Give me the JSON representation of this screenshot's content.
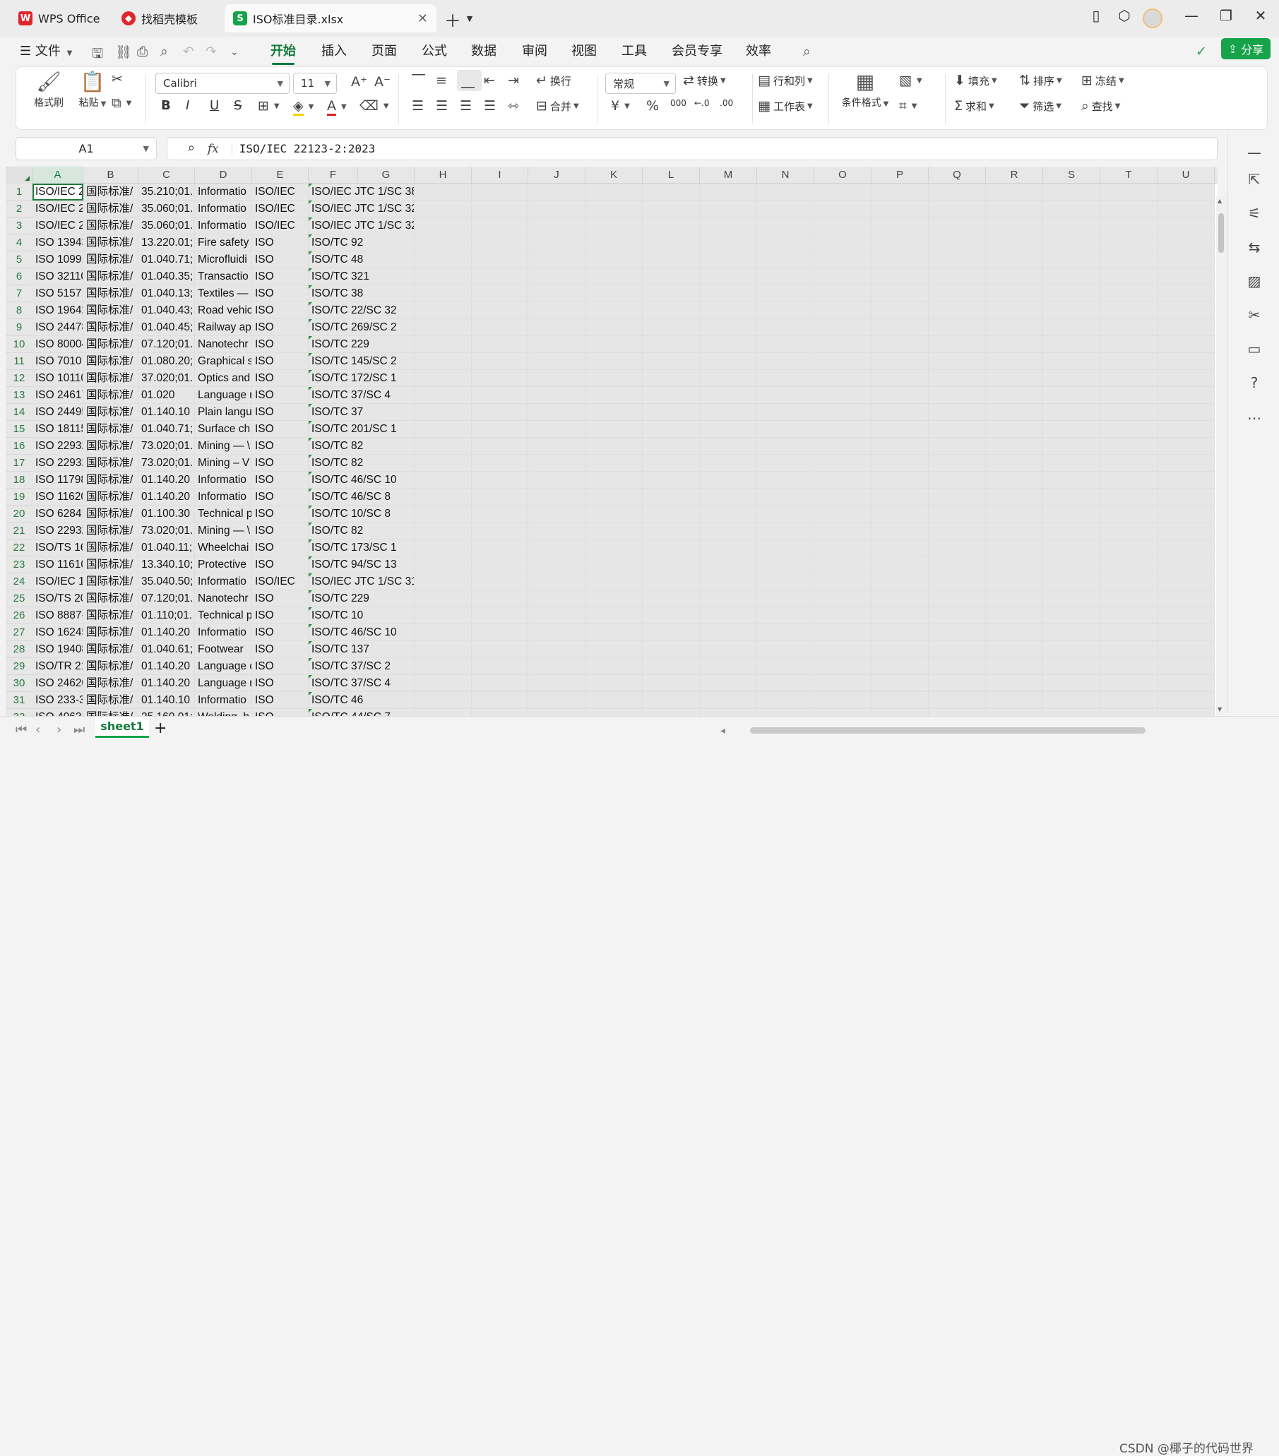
{
  "tabs": {
    "wps": "WPS Office",
    "template": "找稻壳模板",
    "file": "ISO标准目录.xlsx"
  },
  "menu": {
    "file": "文件",
    "items": [
      "开始",
      "插入",
      "页面",
      "公式",
      "数据",
      "审阅",
      "视图",
      "工具",
      "会员专享",
      "效率"
    ],
    "share": "分享"
  },
  "ribbon": {
    "format_painter": "格式刷",
    "paste": "粘贴",
    "font": "Calibri",
    "size": "11",
    "wrap": "换行",
    "merge": "合并",
    "number_format": "常规",
    "convert": "转换",
    "row_col": "行和列",
    "worksheet": "工作表",
    "cond_format": "条件格式",
    "fill": "填充",
    "sort": "排序",
    "freeze": "冻结",
    "sum": "求和",
    "filter": "筛选",
    "find": "查找",
    "currency": "¥",
    "percent": "%",
    "thousands": "000"
  },
  "formula": {
    "name_box": "A1",
    "fx": "fx",
    "content": "ISO/IEC 22123-2:2023"
  },
  "columns": [
    "A",
    "B",
    "C",
    "D",
    "E",
    "F",
    "G",
    "H",
    "I",
    "J",
    "K",
    "L",
    "M",
    "N",
    "O",
    "P",
    "Q",
    "R",
    "S",
    "T",
    "U"
  ],
  "rows": [
    [
      "1",
      "ISO/IEC 22",
      "国际标准/",
      "35.210;01.",
      "Informatio",
      "ISO/IEC",
      "ISO/IEC JTC 1/SC 38"
    ],
    [
      "2",
      "ISO/IEC 21",
      "国际标准/",
      "35.060;01.",
      "Informatio",
      "ISO/IEC",
      "ISO/IEC JTC 1/SC 32"
    ],
    [
      "3",
      "ISO/IEC 21",
      "国际标准/",
      "35.060;01.",
      "Informatio",
      "ISO/IEC",
      "ISO/IEC JTC 1/SC 32"
    ],
    [
      "4",
      "ISO 13943:",
      "国际标准/",
      "13.220.01;",
      "Fire safety",
      "ISO",
      "ISO/TC 92"
    ],
    [
      "5",
      "ISO 10991:",
      "国际标准/",
      "01.040.71;",
      "Microfluidi",
      "ISO",
      "ISO/TC 48"
    ],
    [
      "6",
      "ISO 32110:",
      "国际标准/",
      "01.040.35;",
      "Transactio",
      "ISO",
      "ISO/TC 321"
    ],
    [
      "7",
      "ISO 5157:2",
      "国际标准/",
      "01.040.13;",
      "Textiles —",
      "ISO",
      "ISO/TC 38"
    ],
    [
      "8",
      "ISO 19642-",
      "国际标准/",
      "01.040.43;",
      "Road vehic",
      "ISO",
      "ISO/TC 22/SC 32"
    ],
    [
      "9",
      "ISO 24478:",
      "国际标准/",
      "01.040.45;",
      "Railway ap",
      "ISO",
      "ISO/TC 269/SC 2"
    ],
    [
      "10",
      "ISO 80004-",
      "国际标准/",
      "07.120;01.",
      "Nanotechr",
      "ISO",
      "ISO/TC 229"
    ],
    [
      "11",
      "ISO 7010:2",
      "国际标准/",
      "01.080.20;",
      "Graphical s",
      "ISO",
      "ISO/TC 145/SC 2"
    ],
    [
      "12",
      "ISO 10110-",
      "国际标准/",
      "37.020;01.",
      "Optics and",
      "ISO",
      "ISO/TC 172/SC 1"
    ],
    [
      "13",
      "ISO 24617-",
      "国际标准/",
      "01.020",
      "Language r",
      "ISO",
      "ISO/TC 37/SC 4"
    ],
    [
      "14",
      "ISO 24495-",
      "国际标准/",
      "01.140.10",
      "Plain langu",
      "ISO",
      "ISO/TC 37"
    ],
    [
      "15",
      "ISO 18115-",
      "国际标准/",
      "01.040.71;",
      "Surface ch",
      "ISO",
      "ISO/TC 201/SC 1"
    ],
    [
      "16",
      "ISO 22932-",
      "国际标准/",
      "73.020;01.",
      "Mining — \\",
      "ISO",
      "ISO/TC 82"
    ],
    [
      "17",
      "ISO 22932-",
      "国际标准/",
      "73.020;01.",
      "Mining – V",
      "ISO",
      "ISO/TC 82"
    ],
    [
      "18",
      "ISO 11798:",
      "国际标准/",
      "01.140.20",
      "Informatio",
      "ISO",
      "ISO/TC 46/SC 10"
    ],
    [
      "19",
      "ISO 11620:",
      "国际标准/",
      "01.140.20",
      "Informatio",
      "ISO",
      "ISO/TC 46/SC 8"
    ],
    [
      "20",
      "ISO 6284:2",
      "国际标准/",
      "01.100.30",
      "Technical p",
      "ISO",
      "ISO/TC 10/SC 8"
    ],
    [
      "21",
      "ISO 22932-",
      "国际标准/",
      "73.020;01.",
      "Mining — \\",
      "ISO",
      "ISO/TC 82"
    ],
    [
      "22",
      "ISO/TS 168",
      "国际标准/",
      "01.040.11;",
      "Wheelchai",
      "ISO",
      "ISO/TC 173/SC 1"
    ],
    [
      "23",
      "ISO 11610:",
      "国际标准/",
      "13.340.10;",
      "Protective",
      "ISO",
      "ISO/TC 94/SC 13"
    ],
    [
      "24",
      "ISO/IEC 16",
      "国际标准/",
      "35.040.50;",
      "Informatio",
      "ISO/IEC",
      "ISO/IEC JTC 1/SC 31"
    ],
    [
      "25",
      "ISO/TS 204",
      "国际标准/",
      "07.120;01.",
      "Nanotechr",
      "ISO",
      "ISO/TC 229"
    ],
    [
      "26",
      "ISO 8887-2",
      "国际标准/",
      "01.110;01.",
      "Technical p",
      "ISO",
      "ISO/TC 10"
    ],
    [
      "27",
      "ISO 16245:",
      "国际标准/",
      "01.140.20",
      "Informatio",
      "ISO",
      "ISO/TC 46/SC 10"
    ],
    [
      "28",
      "ISO 19408:",
      "国际标准/",
      "01.040.61;",
      "Footwear",
      "ISO",
      "ISO/TC 137"
    ],
    [
      "29",
      "ISO/TR 21(",
      "国际标准/",
      "01.140.20",
      "Language c",
      "ISO",
      "ISO/TC 37/SC 2"
    ],
    [
      "30",
      "ISO 24620-",
      "国际标准/",
      "01.140.20",
      "Language r",
      "ISO",
      "ISO/TC 37/SC 4"
    ],
    [
      "31",
      "ISO 233-3:",
      "国际标准/",
      "01.140.10",
      "Informatio",
      "ISO",
      "ISO/TC 46"
    ],
    [
      "32",
      "ISO 4063:2",
      "国际标准/",
      "25.160.01;",
      "Welding, b",
      "ISO",
      "ISO/TC 44/SC 7"
    ]
  ],
  "sheet": {
    "name": "sheet1",
    "add": "+"
  },
  "watermark": "CSDN @椰子的代码世界"
}
